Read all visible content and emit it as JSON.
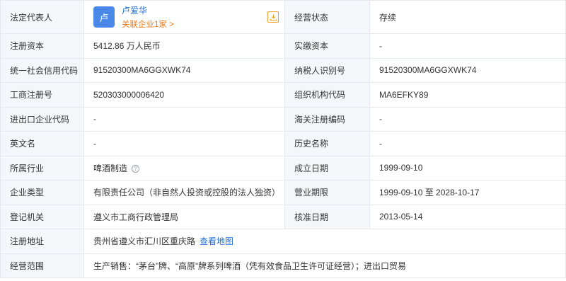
{
  "rows": [
    {
      "legal_rep_label": "法定代表人",
      "legal_rep": {
        "avatar_text": "卢",
        "name": "卢爱华",
        "related": "关联企业1家 >"
      },
      "status_label": "经营状态",
      "status_value": "存续"
    },
    {
      "label1": "注册资本",
      "value1": "5412.86 万人民币",
      "label2": "实缴资本",
      "value2": "-"
    },
    {
      "label1": "统一社会信用代码",
      "value1": "91520300MA6GGXWK74",
      "label2": "纳税人识别号",
      "value2": "91520300MA6GGXWK74"
    },
    {
      "label1": "工商注册号",
      "value1": "520303000006420",
      "label2": "组织机构代码",
      "value2": "MA6EFKY89"
    },
    {
      "label1": "进出口企业代码",
      "value1": "-",
      "label2": "海关注册编码",
      "value2": "-"
    },
    {
      "label1": "英文名",
      "value1": "-",
      "label2": "历史名称",
      "value2": "-"
    },
    {
      "label1": "所属行业",
      "value1": "啤酒制造",
      "help_icon": "?",
      "label2": "成立日期",
      "value2": "1999-09-10"
    },
    {
      "label1": "企业类型",
      "value1": "有限责任公司（非自然人投资或控股的法人独资）",
      "label2": "营业期限",
      "value2": "1999-09-10 至 2028-10-17"
    },
    {
      "label1": "登记机关",
      "value1": "遵义市工商行政管理局",
      "label2": "核准日期",
      "value2": "2013-05-14"
    },
    {
      "label1": "注册地址",
      "value1": "贵州省遵义市汇川区重庆路",
      "map_link": "查看地图"
    },
    {
      "label1": "经营范围",
      "value1": "生产销售：“茅台”牌、“高原”牌系列啤酒（凭有效食品卫生许可证经营）；进出口贸易"
    }
  ],
  "icons": {
    "download": "download-icon",
    "help": "help-circle-icon"
  },
  "colors": {
    "label_bg": "#f4f6fa",
    "border": "#e4e8ef",
    "link_blue": "#1f6fd6",
    "link_orange": "#f07a1a",
    "avatar_bg": "#4a88e8"
  }
}
